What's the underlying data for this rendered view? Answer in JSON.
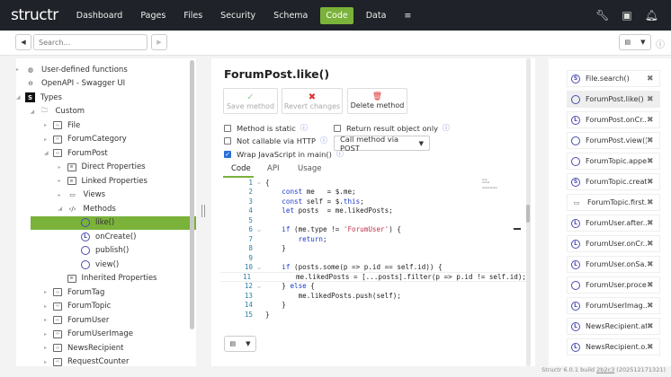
{
  "nav": {
    "logo": "structr",
    "items": [
      "Dashboard",
      "Pages",
      "Files",
      "Security",
      "Schema",
      "Code",
      "Data",
      "≡"
    ],
    "active": "Code"
  },
  "toolbar": {
    "search_placeholder": "Search..."
  },
  "tree": [
    {
      "label": "User-defined functions",
      "level": 0,
      "icon": "globe-functions-icon",
      "tw": "▸"
    },
    {
      "label": "OpenAPI - Swagger UI",
      "level": 0,
      "icon": "openapi-icon",
      "tw": ""
    },
    {
      "label": "Types",
      "level": 0,
      "icon": "structr-s-icon",
      "tw": "◢"
    },
    {
      "label": "Custom",
      "level": 1,
      "icon": "folder-icon",
      "tw": "◢"
    },
    {
      "label": "File",
      "level": 2,
      "icon": "type-icon",
      "tw": "▸"
    },
    {
      "label": "ForumCategory",
      "level": 2,
      "icon": "type-icon",
      "tw": "▸"
    },
    {
      "label": "ForumPost",
      "level": 2,
      "icon": "type-icon",
      "tw": "◢"
    },
    {
      "label": "Direct Properties",
      "level": 3,
      "icon": "properties-icon",
      "tw": "▸"
    },
    {
      "label": "Linked Properties",
      "level": 3,
      "icon": "properties-icon",
      "tw": "▸"
    },
    {
      "label": "Views",
      "level": 3,
      "icon": "monitor-icon",
      "tw": "▸"
    },
    {
      "label": "Methods",
      "level": 3,
      "icon": "code-icon",
      "tw": "◢"
    },
    {
      "label": "like()",
      "level": 4,
      "icon": "method-icon",
      "tw": "",
      "selected": true
    },
    {
      "label": "onCreate()",
      "level": 4,
      "icon": "lifecycle-method-icon",
      "tw": ""
    },
    {
      "label": "publish()",
      "level": 4,
      "icon": "method-icon",
      "tw": ""
    },
    {
      "label": "view()",
      "level": 4,
      "icon": "method-icon",
      "tw": ""
    },
    {
      "label": "Inherited Properties",
      "level": 3,
      "icon": "properties-icon",
      "tw": ""
    },
    {
      "label": "ForumTag",
      "level": 2,
      "icon": "type-icon",
      "tw": "▸"
    },
    {
      "label": "ForumTopic",
      "level": 2,
      "icon": "type-icon",
      "tw": "▸"
    },
    {
      "label": "ForumUser",
      "level": 2,
      "icon": "type-icon",
      "tw": "▸"
    },
    {
      "label": "ForumUserImage",
      "level": 2,
      "icon": "type-icon",
      "tw": "▸"
    },
    {
      "label": "NewsRecipient",
      "level": 2,
      "icon": "type-icon",
      "tw": "▸"
    },
    {
      "label": "RequestCounter",
      "level": 2,
      "icon": "type-icon",
      "tw": "▸"
    }
  ],
  "editor": {
    "title": "ForumPost.like()",
    "buttons": {
      "save": "Save method",
      "revert": "Revert changes",
      "delete": "Delete method"
    },
    "options": {
      "static": "Method is static",
      "not_callable": "Not callable via HTTP",
      "wrap": "Wrap JavaScript in main()",
      "return_only": "Return result object only"
    },
    "wrap_checked": true,
    "call_method": "Call method via POST",
    "tabs": [
      "Code",
      "API",
      "Usage"
    ],
    "active_tab": "Code",
    "code": [
      "{",
      "    const me   = $.me;",
      "    const self = $.this;",
      "    let posts  = me.likedPosts;",
      "",
      "    if (me.type != 'ForumUser') {",
      "        return;",
      "    }",
      "",
      "    if (posts.some(p => p.id == self.id)) {",
      "        me.likedPosts = [...posts].filter(p => p.id != self.id);",
      "    } else {",
      "        me.likedPosts.push(self);",
      "    }",
      "}"
    ],
    "folds": [
      1,
      6,
      10,
      12
    ],
    "current_line": 11
  },
  "open_tabs": [
    {
      "label": "File.search()",
      "icon": "static-method-icon",
      "g": "S"
    },
    {
      "label": "ForumPost.like()",
      "icon": "method-icon",
      "g": "",
      "active": true
    },
    {
      "label": "ForumPost.onCr...",
      "icon": "lifecycle-method-icon",
      "g": "L"
    },
    {
      "label": "ForumPost.view()",
      "icon": "method-icon",
      "g": ""
    },
    {
      "label": "ForumTopic.appe...",
      "icon": "method-icon",
      "g": ""
    },
    {
      "label": "ForumTopic.creat...",
      "icon": "static-method-icon",
      "g": "S"
    },
    {
      "label": "ForumTopic.first...",
      "icon": "view-icon",
      "g": "▭"
    },
    {
      "label": "ForumUser.after...",
      "icon": "lifecycle-method-icon",
      "g": "L"
    },
    {
      "label": "ForumUser.onCr...",
      "icon": "lifecycle-method-icon",
      "g": "L"
    },
    {
      "label": "ForumUser.onSa...",
      "icon": "lifecycle-method-icon",
      "g": "L"
    },
    {
      "label": "ForumUser.proce...",
      "icon": "method-icon",
      "g": ""
    },
    {
      "label": "ForumUserImag...",
      "icon": "lifecycle-method-icon",
      "g": "L"
    },
    {
      "label": "NewsRecipient.af...",
      "icon": "lifecycle-method-icon",
      "g": "L"
    },
    {
      "label": "NewsRecipient.o...",
      "icon": "lifecycle-method-icon",
      "g": "L"
    }
  ],
  "footer": {
    "text": "Structr 6.0.1 build ",
    "build": "2b2c3",
    "date": " (202512171321)"
  },
  "colors": {
    "accent": "#7ab23a",
    "nav_bg": "#1f2228",
    "method_icon": "#4a4ab0"
  }
}
